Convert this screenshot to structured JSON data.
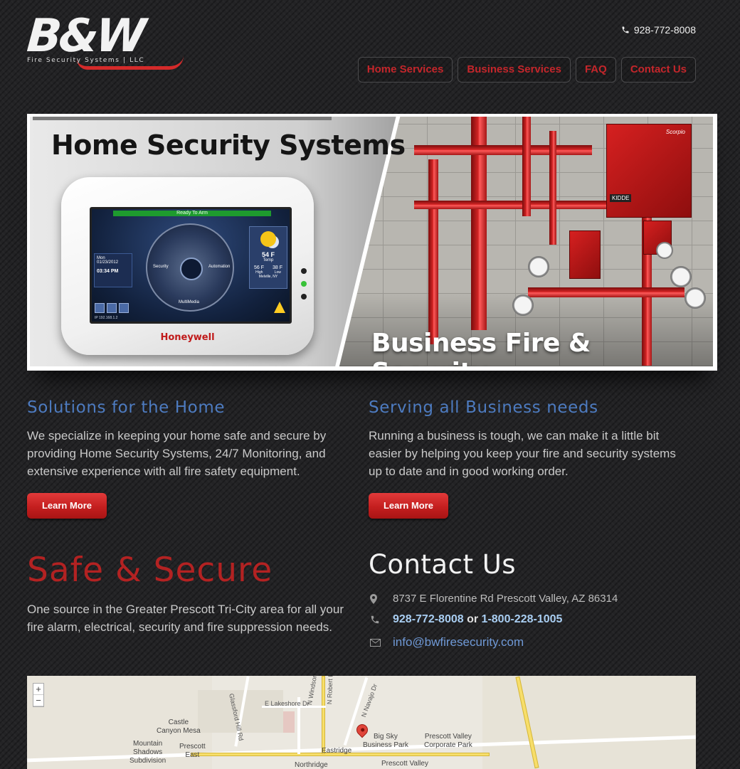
{
  "header": {
    "logo_mark": "B&W",
    "logo_subtitle": "Fire Security Systems | LLC",
    "phone": "928-772-8008",
    "nav": [
      "Home Services",
      "Business Services",
      "FAQ",
      "Contact Us"
    ]
  },
  "hero": {
    "left_title": "Home Security Systems",
    "right_title": "Business Fire & Security",
    "device": {
      "status": "Ready To Arm",
      "day": "Mon",
      "date": "01/23/2012",
      "time": "03:34 PM",
      "security": "Security",
      "automation": "Automation",
      "multimedia": "MultiMedia",
      "temp": "54 F",
      "temp_label": "Temp",
      "high": "56 F",
      "low": "38 F",
      "high_label": "High",
      "low_label": "Low",
      "location": "Melville, NY",
      "ip": "IP 192.168.1.2",
      "brand": "Honeywell"
    },
    "equipment": {
      "panel_brand": "Scorpio",
      "panel_maker": "KIDDE"
    }
  },
  "home_section": {
    "title": "Solutions for the Home",
    "text": "We specialize in keeping your home safe and secure by providing Home Security Systems, 24/7 Monitoring, and extensive experience with all fire safety equipment.",
    "button": "Learn More"
  },
  "business_section": {
    "title": "Serving all Business needs",
    "text": "Running a business is tough, we can make it a little bit easier by helping you keep your fire and security systems up to date and in good working order.",
    "button": "Learn More"
  },
  "safe": {
    "title": "Safe & Secure",
    "text": "One source in the Greater Prescott Tri-City area for all your fire alarm, electrical, security and fire suppression needs."
  },
  "contact": {
    "title": "Contact Us",
    "address": "8737 E Florentine Rd Prescott Valley, AZ 86314",
    "phone1": "928-772-8008",
    "or": "or",
    "phone2": "1-800-228-1005",
    "email": "info@bwfiresecurity.com"
  },
  "map": {
    "zoom_in": "+",
    "zoom_out": "−",
    "labels": {
      "castle": "Castle\nCanyon Mesa",
      "mountain": "Mountain\nShadows\nSubdivision",
      "prescott_east": "Prescott\nEast",
      "big_sky": "Big Sky\nBusiness Park",
      "pv_corp": "Prescott Valley\nCorporate Park",
      "eastridge": "Eastridge",
      "northridge": "Northridge",
      "prescott_valley": "Prescott Valley"
    },
    "roads": {
      "glassford": "Glassford Hill Rd",
      "lakeshore": "E Lakeshore Dr",
      "windsong": "N Windsong Dr",
      "robert": "N Robert Rd",
      "navajo": "N Navajo Dr"
    }
  }
}
